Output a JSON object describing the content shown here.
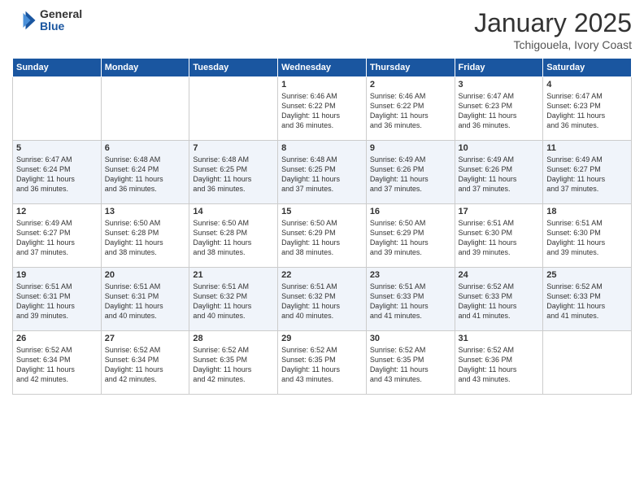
{
  "logo": {
    "general": "General",
    "blue": "Blue"
  },
  "header": {
    "month": "January 2025",
    "location": "Tchigouela, Ivory Coast"
  },
  "days_of_week": [
    "Sunday",
    "Monday",
    "Tuesday",
    "Wednesday",
    "Thursday",
    "Friday",
    "Saturday"
  ],
  "weeks": [
    [
      {
        "day": "",
        "info": ""
      },
      {
        "day": "",
        "info": ""
      },
      {
        "day": "",
        "info": ""
      },
      {
        "day": "1",
        "info": "Sunrise: 6:46 AM\nSunset: 6:22 PM\nDaylight: 11 hours\nand 36 minutes."
      },
      {
        "day": "2",
        "info": "Sunrise: 6:46 AM\nSunset: 6:22 PM\nDaylight: 11 hours\nand 36 minutes."
      },
      {
        "day": "3",
        "info": "Sunrise: 6:47 AM\nSunset: 6:23 PM\nDaylight: 11 hours\nand 36 minutes."
      },
      {
        "day": "4",
        "info": "Sunrise: 6:47 AM\nSunset: 6:23 PM\nDaylight: 11 hours\nand 36 minutes."
      }
    ],
    [
      {
        "day": "5",
        "info": "Sunrise: 6:47 AM\nSunset: 6:24 PM\nDaylight: 11 hours\nand 36 minutes."
      },
      {
        "day": "6",
        "info": "Sunrise: 6:48 AM\nSunset: 6:24 PM\nDaylight: 11 hours\nand 36 minutes."
      },
      {
        "day": "7",
        "info": "Sunrise: 6:48 AM\nSunset: 6:25 PM\nDaylight: 11 hours\nand 36 minutes."
      },
      {
        "day": "8",
        "info": "Sunrise: 6:48 AM\nSunset: 6:25 PM\nDaylight: 11 hours\nand 37 minutes."
      },
      {
        "day": "9",
        "info": "Sunrise: 6:49 AM\nSunset: 6:26 PM\nDaylight: 11 hours\nand 37 minutes."
      },
      {
        "day": "10",
        "info": "Sunrise: 6:49 AM\nSunset: 6:26 PM\nDaylight: 11 hours\nand 37 minutes."
      },
      {
        "day": "11",
        "info": "Sunrise: 6:49 AM\nSunset: 6:27 PM\nDaylight: 11 hours\nand 37 minutes."
      }
    ],
    [
      {
        "day": "12",
        "info": "Sunrise: 6:49 AM\nSunset: 6:27 PM\nDaylight: 11 hours\nand 37 minutes."
      },
      {
        "day": "13",
        "info": "Sunrise: 6:50 AM\nSunset: 6:28 PM\nDaylight: 11 hours\nand 38 minutes."
      },
      {
        "day": "14",
        "info": "Sunrise: 6:50 AM\nSunset: 6:28 PM\nDaylight: 11 hours\nand 38 minutes."
      },
      {
        "day": "15",
        "info": "Sunrise: 6:50 AM\nSunset: 6:29 PM\nDaylight: 11 hours\nand 38 minutes."
      },
      {
        "day": "16",
        "info": "Sunrise: 6:50 AM\nSunset: 6:29 PM\nDaylight: 11 hours\nand 39 minutes."
      },
      {
        "day": "17",
        "info": "Sunrise: 6:51 AM\nSunset: 6:30 PM\nDaylight: 11 hours\nand 39 minutes."
      },
      {
        "day": "18",
        "info": "Sunrise: 6:51 AM\nSunset: 6:30 PM\nDaylight: 11 hours\nand 39 minutes."
      }
    ],
    [
      {
        "day": "19",
        "info": "Sunrise: 6:51 AM\nSunset: 6:31 PM\nDaylight: 11 hours\nand 39 minutes."
      },
      {
        "day": "20",
        "info": "Sunrise: 6:51 AM\nSunset: 6:31 PM\nDaylight: 11 hours\nand 40 minutes."
      },
      {
        "day": "21",
        "info": "Sunrise: 6:51 AM\nSunset: 6:32 PM\nDaylight: 11 hours\nand 40 minutes."
      },
      {
        "day": "22",
        "info": "Sunrise: 6:51 AM\nSunset: 6:32 PM\nDaylight: 11 hours\nand 40 minutes."
      },
      {
        "day": "23",
        "info": "Sunrise: 6:51 AM\nSunset: 6:33 PM\nDaylight: 11 hours\nand 41 minutes."
      },
      {
        "day": "24",
        "info": "Sunrise: 6:52 AM\nSunset: 6:33 PM\nDaylight: 11 hours\nand 41 minutes."
      },
      {
        "day": "25",
        "info": "Sunrise: 6:52 AM\nSunset: 6:33 PM\nDaylight: 11 hours\nand 41 minutes."
      }
    ],
    [
      {
        "day": "26",
        "info": "Sunrise: 6:52 AM\nSunset: 6:34 PM\nDaylight: 11 hours\nand 42 minutes."
      },
      {
        "day": "27",
        "info": "Sunrise: 6:52 AM\nSunset: 6:34 PM\nDaylight: 11 hours\nand 42 minutes."
      },
      {
        "day": "28",
        "info": "Sunrise: 6:52 AM\nSunset: 6:35 PM\nDaylight: 11 hours\nand 42 minutes."
      },
      {
        "day": "29",
        "info": "Sunrise: 6:52 AM\nSunset: 6:35 PM\nDaylight: 11 hours\nand 43 minutes."
      },
      {
        "day": "30",
        "info": "Sunrise: 6:52 AM\nSunset: 6:35 PM\nDaylight: 11 hours\nand 43 minutes."
      },
      {
        "day": "31",
        "info": "Sunrise: 6:52 AM\nSunset: 6:36 PM\nDaylight: 11 hours\nand 43 minutes."
      },
      {
        "day": "",
        "info": ""
      }
    ]
  ]
}
